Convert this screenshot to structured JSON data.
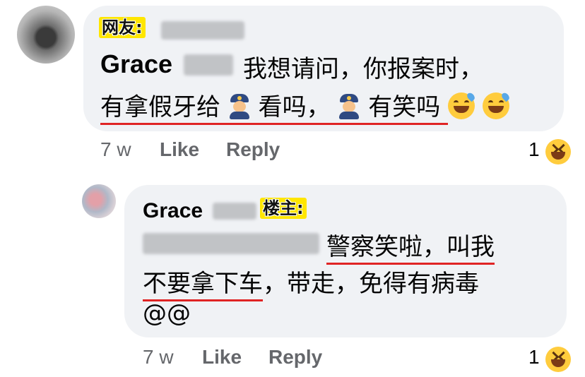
{
  "comment": {
    "tag": "网友:",
    "author": "Grace",
    "line1_text": "我想请问，你报案时，",
    "line2_part1": "有拿假牙给",
    "line2_part2": "看吗，",
    "line2_part3": "有笑吗",
    "time": "7 w",
    "like_label": "Like",
    "reply_label": "Reply",
    "reaction_count": "1",
    "icons": [
      "police-officer-emoji",
      "sweat-smile-emoji",
      "laughing-reaction-icon"
    ]
  },
  "reply": {
    "author": "Grace",
    "tag": "楼主:",
    "line1_text": "警察笑啦，叫我",
    "line2_part1": "不要拿下车",
    "line2_part2": "，带走，免得有病毒",
    "line3_text": "@@",
    "time": "7 w",
    "like_label": "Like",
    "reply_label": "Reply",
    "reaction_count": "1"
  },
  "colors": {
    "bubble": "#f0f2f5",
    "tag_highlight": "#ffe600",
    "underline": "#e02424",
    "meta_text": "#65676b"
  }
}
